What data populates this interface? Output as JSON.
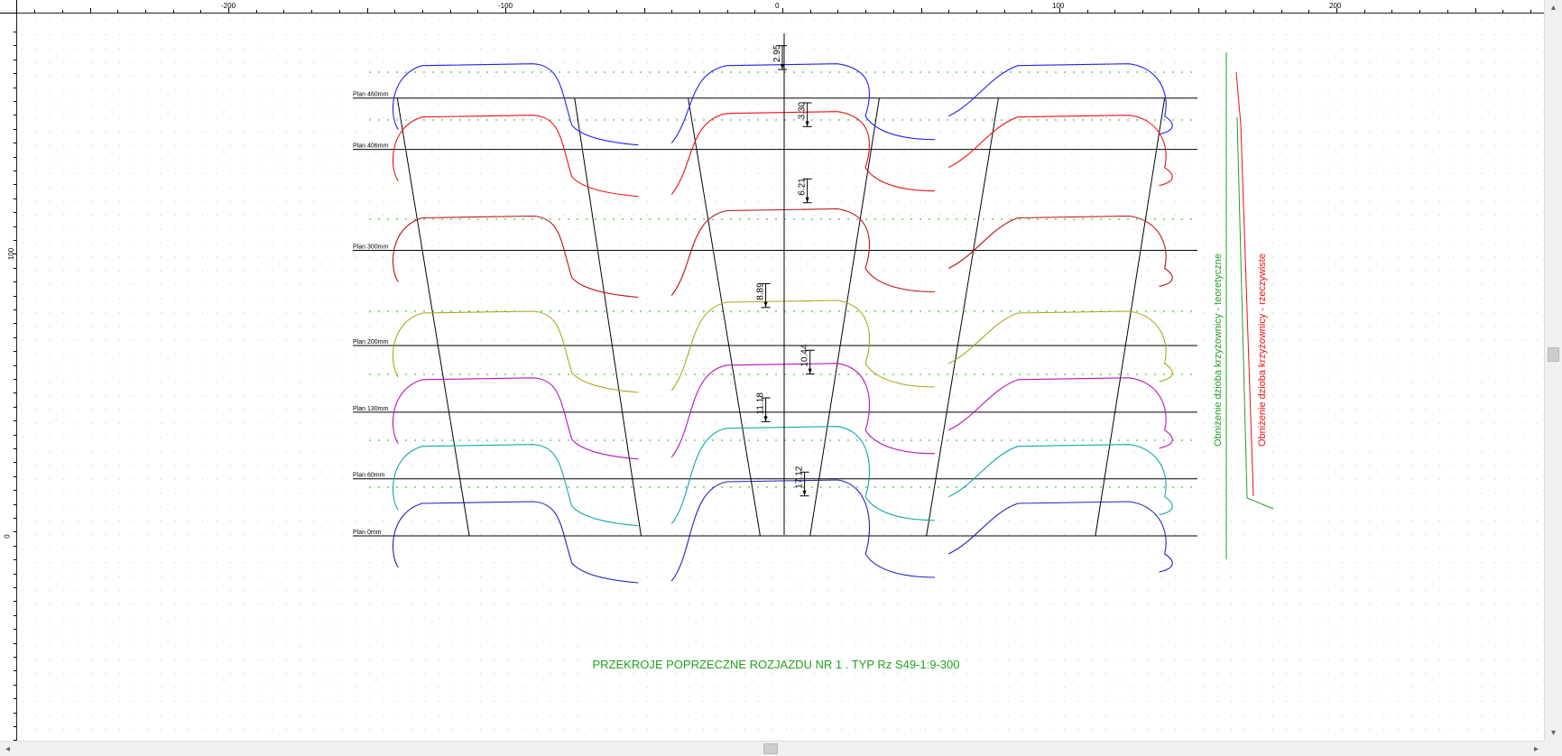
{
  "title": "PRZEKROJE POPRZECZNE ROZJAZDU NR 1 . TYP Rz S49-1:9-300",
  "ruler": {
    "x_ticks": [
      "-200",
      "-100",
      "0",
      "100",
      "200"
    ],
    "y_ticks": [
      "100",
      "0"
    ]
  },
  "planes": [
    {
      "label": "Plan 460mm",
      "y": 460
    },
    {
      "label": "Plan 406mm",
      "y": 406
    },
    {
      "label": "Plan 300mm",
      "y": 300
    },
    {
      "label": "Plan 200mm",
      "y": 200
    },
    {
      "label": "Plan 130mm",
      "y": 130
    },
    {
      "label": "Plan 60mm",
      "y": 60
    },
    {
      "label": "Plan 0mm",
      "y": 0
    }
  ],
  "dimensions": [
    {
      "label": "2.95",
      "x": 0,
      "y_top": 515,
      "y_bottom": 490
    },
    {
      "label": "3.30",
      "x": 9,
      "y_top": 455,
      "y_bottom": 430
    },
    {
      "label": "6.21",
      "x": 9,
      "y_top": 375,
      "y_bottom": 350
    },
    {
      "label": "8.89",
      "x": -6,
      "y_top": 265,
      "y_bottom": 240
    },
    {
      "label": "10.44",
      "x": 10,
      "y_top": 195,
      "y_bottom": 170
    },
    {
      "label": "11.18",
      "x": -6,
      "y_top": 145,
      "y_bottom": 120
    },
    {
      "label": "17.12",
      "x": 8,
      "y_top": 67,
      "y_bottom": 42
    }
  ],
  "legend": {
    "theoretical": "Obniżenie dzioba krzyżownicy - teoretyczne",
    "actual": "Obniżenie dzioba krzyżownicy - rzeczywiste",
    "theoretical_color": "#22a022",
    "actual_color": "#ee1111"
  },
  "profile_colors": [
    "#2222ee",
    "#ee1111",
    "#bb1111",
    "#a8a81a",
    "#bb11bb",
    "#11a8a8",
    "#2222bb"
  ],
  "grid_color": "#909090",
  "green_dash_color": "#22b022"
}
